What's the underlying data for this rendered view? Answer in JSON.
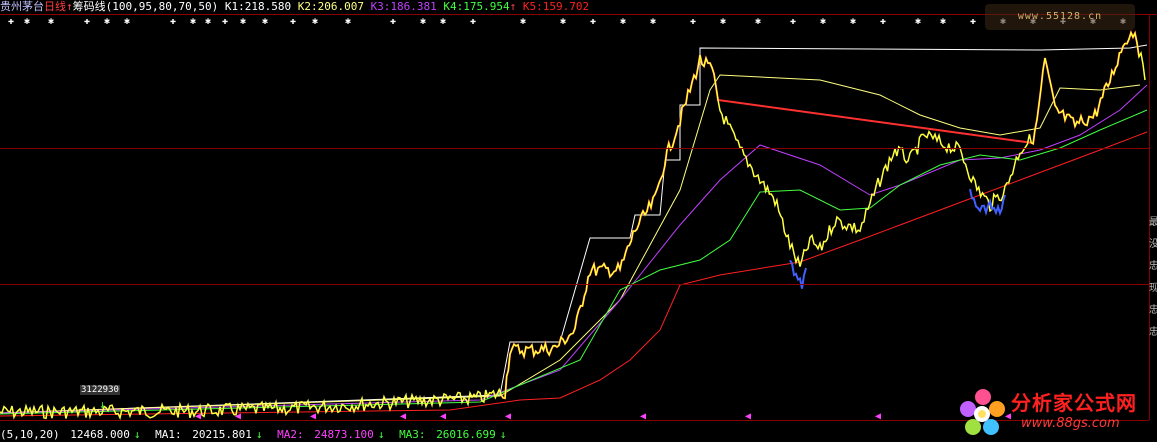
{
  "header": {
    "stock": "贵州茅台",
    "period": "日线",
    "indicator": "筹码线",
    "params": "(100,95,80,70,50)",
    "k1_label": "K1:",
    "k1": "218.580",
    "k2_label": "K2:",
    "k2": "206.007",
    "k3_label": "K3:",
    "k3": "186.381",
    "k4_label": "K4:",
    "k4": "175.954",
    "k4_arrow": "↑",
    "k5_label": "K5:",
    "k5": "159.702"
  },
  "volume_bar": {
    "params": "(5,10,20)",
    "vol": "12468.000",
    "vol_arrow": "↓",
    "ma1_label": "MA1:",
    "ma1": "20215.801",
    "ma1_arrow": "↓",
    "ma2_label": "MA2:",
    "ma2": "24873.100",
    "ma2_arrow": "↓",
    "ma3_label": "MA3:",
    "ma3": "26016.699",
    "ma3_arrow": "↓"
  },
  "price_label": "3122930",
  "side_chars": [
    "最",
    "没",
    "忠",
    "现",
    "忠",
    "忠"
  ],
  "watermark": {
    "title": "分析家公式网",
    "url": "www.88gs.com",
    "top_text": "www.55128.cn"
  },
  "colors": {
    "k1": "#ffffff",
    "k2": "#ffff80",
    "k3": "#c040ff",
    "k4": "#40ff40",
    "k5": "#ff2020",
    "candle_up": "#ff3030",
    "candle_flat": "#ffff40",
    "candle_down": "#4060ff",
    "grid": "#8a0000"
  }
}
